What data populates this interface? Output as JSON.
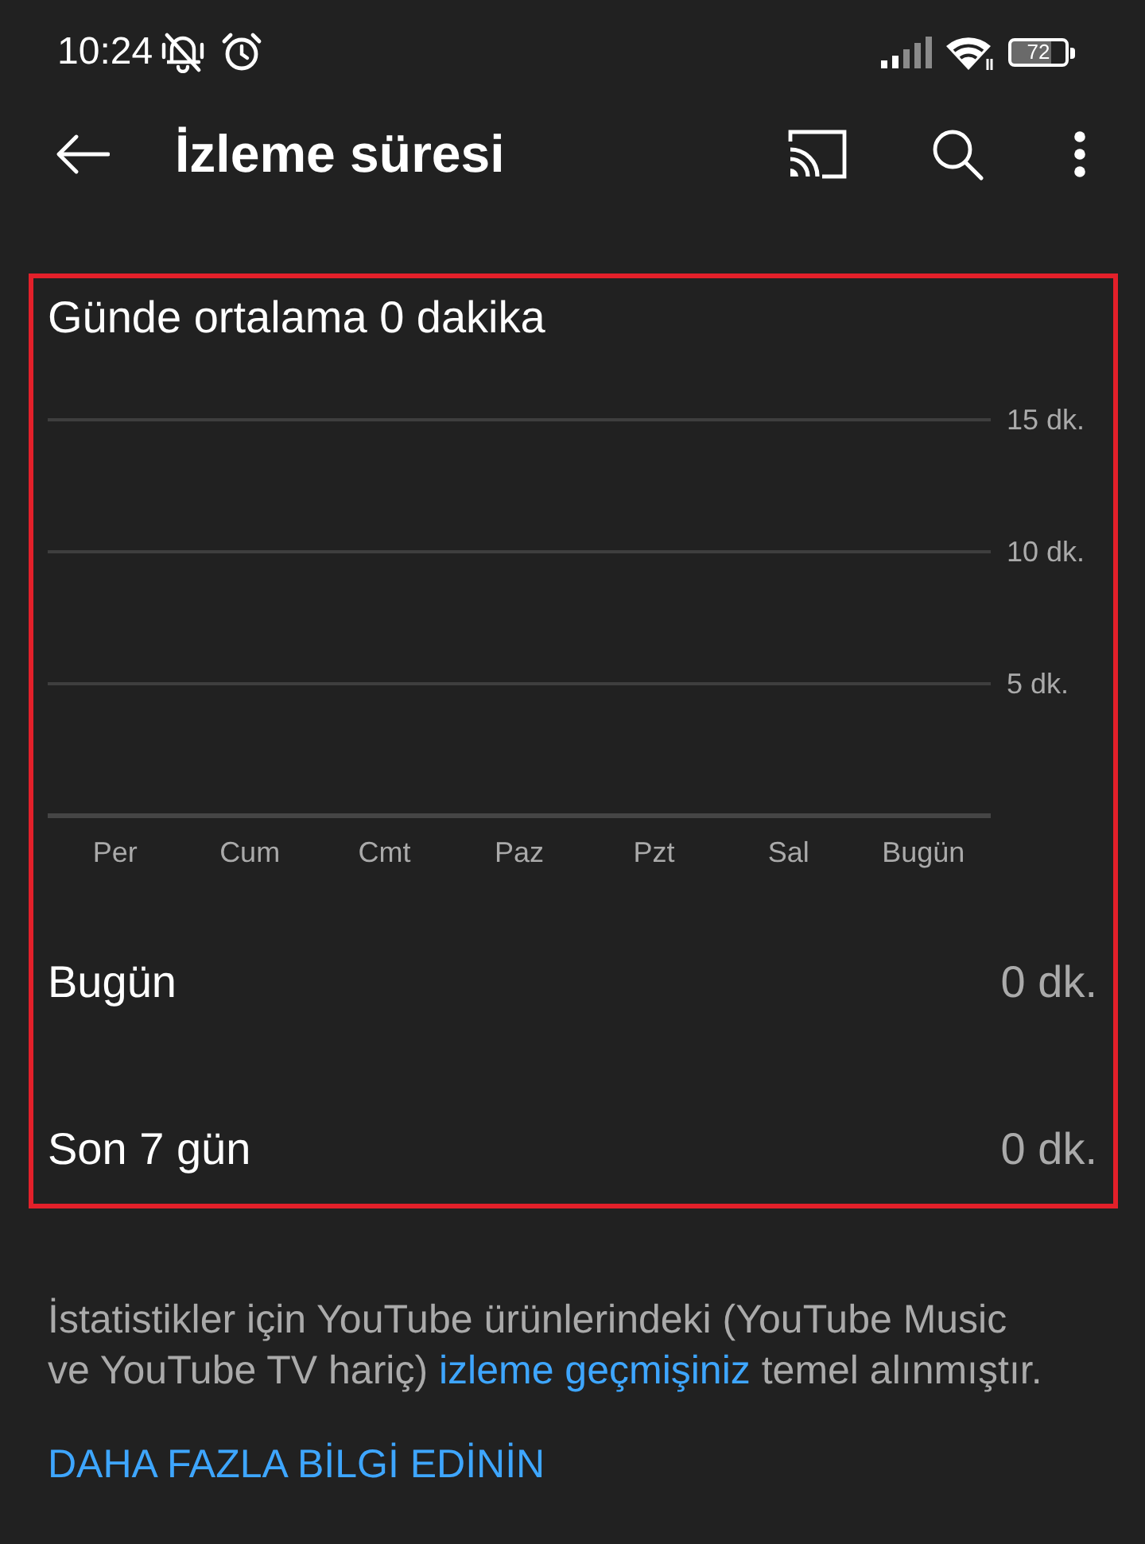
{
  "status_bar": {
    "time": "10:24",
    "battery": "72"
  },
  "app_bar": {
    "title": "İzleme süresi"
  },
  "stats": {
    "highlighted": true,
    "title": "Günde ortalama 0 dakika",
    "chart_data": {
      "type": "bar",
      "categories": [
        "Per",
        "Cum",
        "Cmt",
        "Paz",
        "Pzt",
        "Sal",
        "Bugün"
      ],
      "values": [
        0,
        0,
        0,
        0,
        0,
        0,
        0
      ],
      "ylim": [
        0,
        15
      ],
      "yticks": [
        {
          "value": 5,
          "label": "5 dk."
        },
        {
          "value": 10,
          "label": "10 dk."
        },
        {
          "value": 15,
          "label": "15 dk."
        }
      ]
    },
    "rows": [
      {
        "label": "Bugün",
        "value": "0 dk."
      },
      {
        "label": "Son 7 gün",
        "value": "0 dk."
      }
    ]
  },
  "footer": {
    "note_before": "İstatistikler için YouTube ürünlerindeki (YouTube Music ve YouTube TV hariç)",
    "note_link": "izleme geçmişiniz",
    "note_after": "temel alınmıştır.",
    "learn_more": "DAHA FAZLA BİLGİ EDİNİN"
  }
}
